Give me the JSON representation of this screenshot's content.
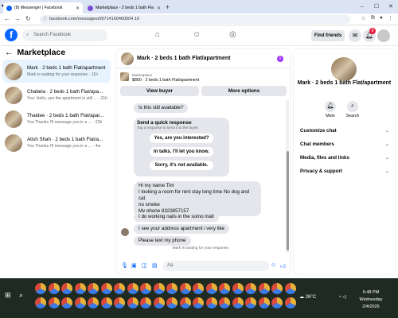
{
  "browser": {
    "tabs": [
      {
        "title": "(8) Messenger | Facebook",
        "favicon_color": "#0866ff"
      },
      {
        "title": "Marketplace - 2 beds 1 bath Fla",
        "favicon_color": "#7b4bd6"
      }
    ],
    "url": "facebook.com/messages/t/9714160460504 19",
    "new_tab_label": "+",
    "window_controls": [
      "–",
      "☐",
      "✕"
    ]
  },
  "fb_header": {
    "logo": "f",
    "search_placeholder": "Search Facebook",
    "find_friends_label": "Find friends",
    "notif_count": "8"
  },
  "left_panel": {
    "title": "Marketplace",
    "conversations": [
      {
        "name": "Mark · 2 beds 1 bath Flat/apartment",
        "preview": "Mark is waiting for your response · 11h",
        "active": true
      },
      {
        "name": "Chabela · 2 beds 1 bath Flat/apa...",
        "preview": "You: Hello, yes the apartment is still ... · 21h",
        "active": false
      },
      {
        "name": "Thaidee · 2 beds 1 bath Flat/apar...",
        "preview": "You Thanks I'll message you in a ... · 22h",
        "active": false
      },
      {
        "name": "Atish Shah · 2 beds 1 bath Flat/a...",
        "preview": "You Thanks I'll message you in a ... · 4w",
        "active": false
      }
    ]
  },
  "chat": {
    "title": "Mark · 2 beds 1 bath Flat/apartment",
    "marketplace_label": "Marketplace",
    "listing": "$800 · 2 beds 1 bath Flat/apartment",
    "view_buyer_label": "View buyer",
    "more_options_label": "More options",
    "first_message": "Is this still available?",
    "quick_response": {
      "heading": "Send a quick response",
      "subheading": "Tap a response to send it to the buyer.",
      "options": [
        "Yes, are you interested?",
        "In talks. I'll let you know.",
        "Sorry, it's not available."
      ]
    },
    "messages": [
      {
        "lines": [
          "Hi my name Tim",
          "I looking a room for rent stay long time  No dog and cat",
          "no smoke",
          "My phone 8323857157"
        ]
      },
      {
        "lines": [
          "I do working nails in the somo mall"
        ]
      },
      {
        "lines": [
          "I see your address apartment i very like"
        ]
      },
      {
        "lines": [
          "Please text my phone"
        ]
      }
    ],
    "waiting_text": "Mark is waiting for your response.",
    "composer_placeholder": "Aa"
  },
  "right_panel": {
    "title": "Mark · 2 beds 1 bath Flat/apartment",
    "mute_label": "Mute",
    "search_label": "Search",
    "sections": [
      "Customize chat",
      "Chat members",
      "Media, files and links",
      "Privacy & support"
    ]
  },
  "taskbar": {
    "weather_temp": "26°C",
    "time": "6:48 PM",
    "day": "Wednesday",
    "date": "2/4/2026"
  }
}
